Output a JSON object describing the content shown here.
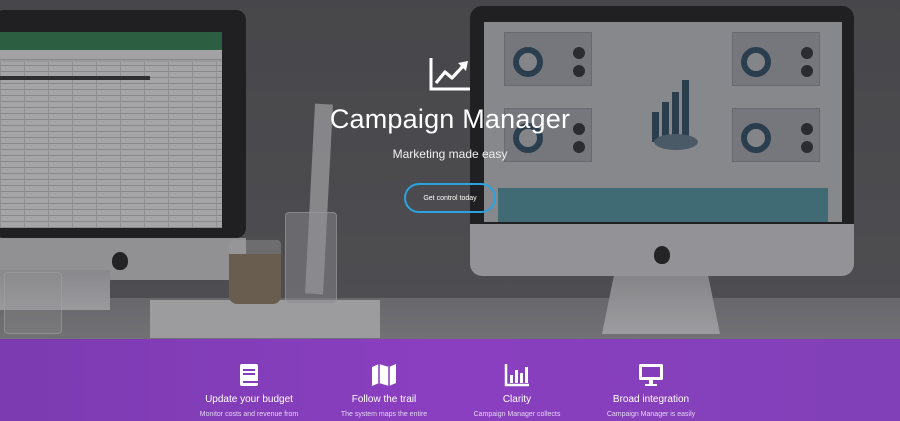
{
  "hero": {
    "title": "Campaign Manager",
    "subtitle": "Marketing made easy",
    "cta_label": "Get control today",
    "logo_icon": "trend-chart-icon",
    "accent_color": "#2aa3df"
  },
  "features": {
    "background_color": "#843dba",
    "items": [
      {
        "icon": "book-icon",
        "title": "Update your budget",
        "desc": "Monitor costs and revenue from"
      },
      {
        "icon": "map-icon",
        "title": "Follow the trail",
        "desc": "The system maps the entire"
      },
      {
        "icon": "bar-chart-icon",
        "title": "Clarity",
        "desc": "Campaign Manager collects"
      },
      {
        "icon": "monitor-icon",
        "title": "Broad integration",
        "desc": "Campaign Manager is easily"
      }
    ]
  }
}
